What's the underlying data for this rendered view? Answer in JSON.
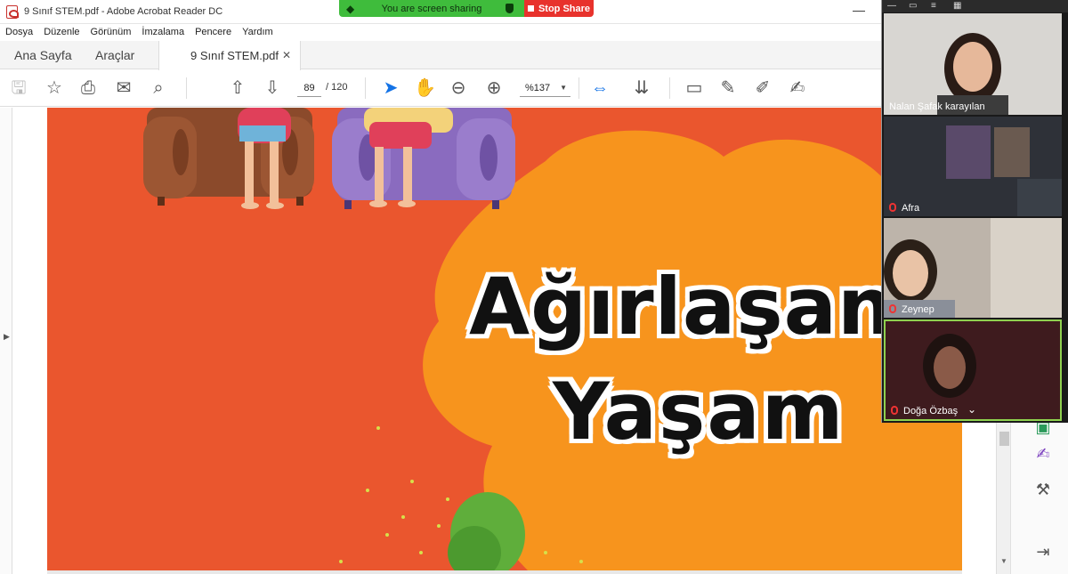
{
  "window": {
    "title": "9 Sınıf STEM.pdf - Adobe Acrobat Reader DC"
  },
  "share_banner": {
    "text": "You are screen sharing",
    "stop_label": "Stop Share"
  },
  "menu": [
    "Dosya",
    "Düzenle",
    "Görünüm",
    "İmzalama",
    "Pencere",
    "Yardım"
  ],
  "tabs": {
    "home": "Ana Sayfa",
    "tools": "Araçlar",
    "document": "9 Sınıf STEM.pdf",
    "help": "?"
  },
  "toolbar": {
    "page_current": "89",
    "page_total": "/ 120",
    "zoom": "%137"
  },
  "document": {
    "title_line1": "Ağırlaşan",
    "title_line2": "Yaşam"
  },
  "participants": [
    {
      "name": "Nalan Şafak karayılan",
      "muted": false
    },
    {
      "name": "Afra",
      "muted": true
    },
    {
      "name": "Zeynep",
      "muted": true
    },
    {
      "name": "Doğa Özbaş",
      "muted": true
    }
  ],
  "colors": {
    "page_bg": "#ea562e",
    "blob": "#f7941d",
    "share_green": "#3fbc3c",
    "stop_red": "#e8322c"
  }
}
